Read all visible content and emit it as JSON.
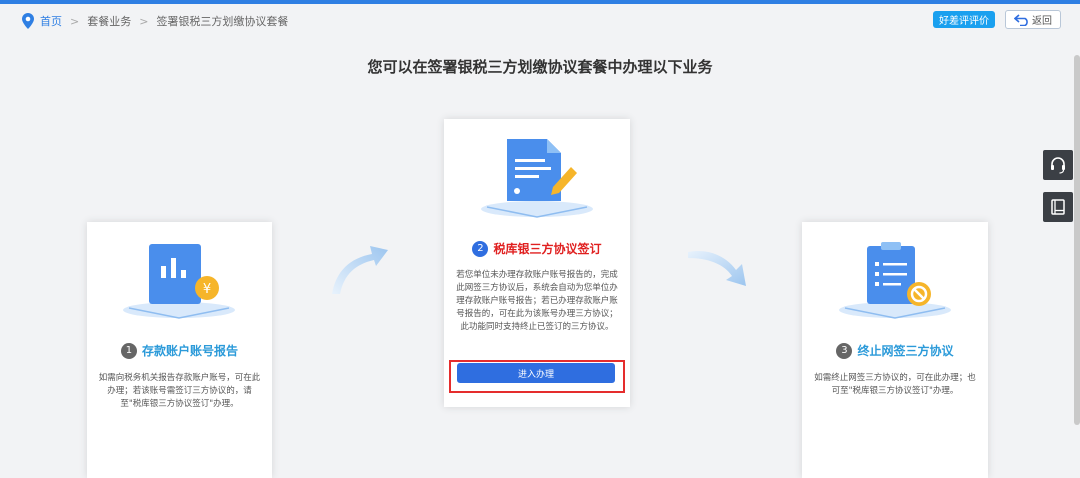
{
  "breadcrumb": {
    "home": "首页",
    "sep": ">",
    "level1": "套餐业务",
    "level2": "签署银税三方划缴协议套餐"
  },
  "header": {
    "rate_label": "好差评评价",
    "back_label": "返回"
  },
  "main": {
    "heading": "您可以在签署银税三方划缴协议套餐中办理以下业务",
    "cards": [
      {
        "number": "1",
        "title": "存款账户账号报告",
        "desc": "如需向税务机关报告存款账户账号，可在此办理；若该账号需签订三方协议的，请至\"税库银三方协议签订\"办理。"
      },
      {
        "number": "2",
        "title": "税库银三方协议签订",
        "desc": "若您单位未办理存款账户账号报告的，完成此网签三方协议后，系统会自动为您单位办理存款账户账号报告；若已办理存款账户账号报告的，可在此为该账号办理三方协议；此功能同时支持终止已签订的三方协议。",
        "button": "进入办理"
      },
      {
        "number": "3",
        "title": "终止网签三方协议",
        "desc": "如需终止网签三方协议的，可在此办理；也可至\"税库银三方协议签订\"办理。"
      }
    ]
  },
  "side": {
    "icons": [
      "headset-icon",
      "book-icon"
    ]
  },
  "colors": {
    "accent": "#2f6ee0",
    "highlight": "#e52d2d",
    "title_blue": "#2b9ad9",
    "title_red": "#e02020"
  }
}
